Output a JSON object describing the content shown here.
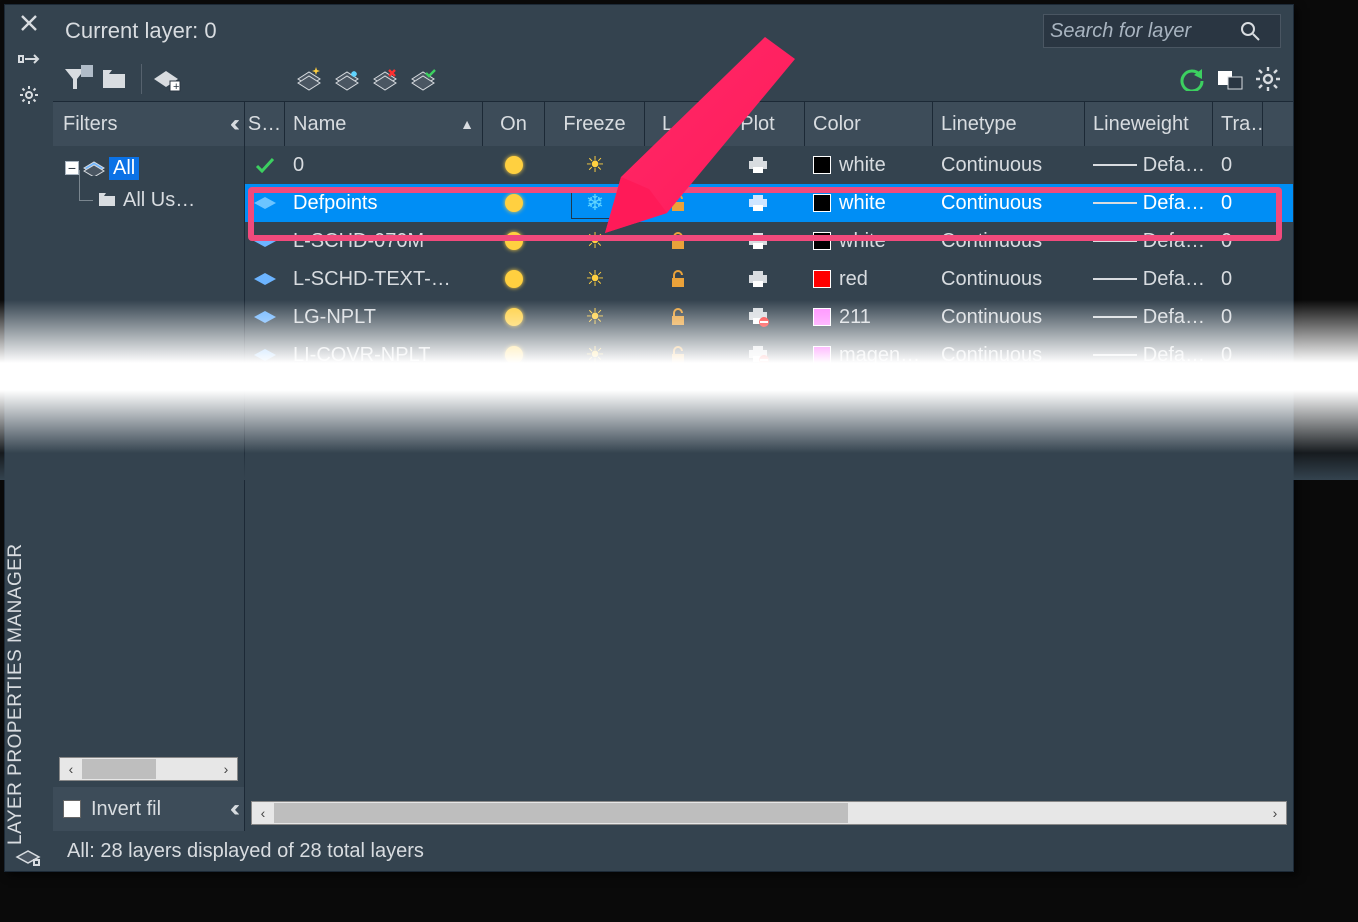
{
  "panelTitle": "LAYER PROPERTIES MANAGER",
  "header": {
    "current_layer": "Current layer: 0"
  },
  "search": {
    "placeholder": "Search for layer"
  },
  "filters": {
    "title": "Filters",
    "all": "All",
    "all_used": "All Us…",
    "invert": "Invert fil"
  },
  "columns": {
    "s": "S…",
    "name": "Name",
    "on": "On",
    "freeze": "Freeze",
    "lock": "L…",
    "plot": "Plot",
    "color": "Color",
    "linetype": "Linetype",
    "lineweight": "Lineweight",
    "transparency": "Tra…"
  },
  "rows": [
    {
      "s": "current",
      "name": "0",
      "on": true,
      "frozen": false,
      "locked": false,
      "plot": true,
      "color": "white",
      "hex": "#000000",
      "ltype": "Continuous",
      "lw": "Defa…",
      "tr": "0"
    },
    {
      "s": "layer",
      "name": "Defpoints",
      "on": true,
      "frozen": true,
      "locked": false,
      "plot": true,
      "color": "white",
      "hex": "#000000",
      "ltype": "Continuous",
      "lw": "Defa…",
      "tr": "0",
      "selected": true
    },
    {
      "s": "layer",
      "name": "L-SCHD-070M",
      "on": true,
      "frozen": false,
      "locked": false,
      "plot": true,
      "color": "white",
      "hex": "#000000",
      "ltype": "Continuous",
      "lw": "Defa…",
      "tr": "0"
    },
    {
      "s": "layer",
      "name": "L-SCHD-TEXT-…",
      "on": true,
      "frozen": false,
      "locked": false,
      "plot": true,
      "color": "red",
      "hex": "#ff0000",
      "ltype": "Continuous",
      "lw": "Defa…",
      "tr": "0"
    },
    {
      "s": "layer",
      "name": "LG-NPLT",
      "on": true,
      "frozen": false,
      "locked": false,
      "plot": false,
      "color": "211",
      "hex": "#ff8aff",
      "ltype": "Continuous",
      "lw": "Defa…",
      "tr": "0"
    },
    {
      "s": "layer",
      "name": "LI-COVR-NPLT",
      "on": true,
      "frozen": false,
      "locked": false,
      "plot": false,
      "color": "magen…",
      "hex": "#ff00ff",
      "ltype": "Continuous",
      "lw": "Defa…",
      "tr": "0"
    }
  ],
  "footer": "All: 28 layers displayed of 28 total layers"
}
